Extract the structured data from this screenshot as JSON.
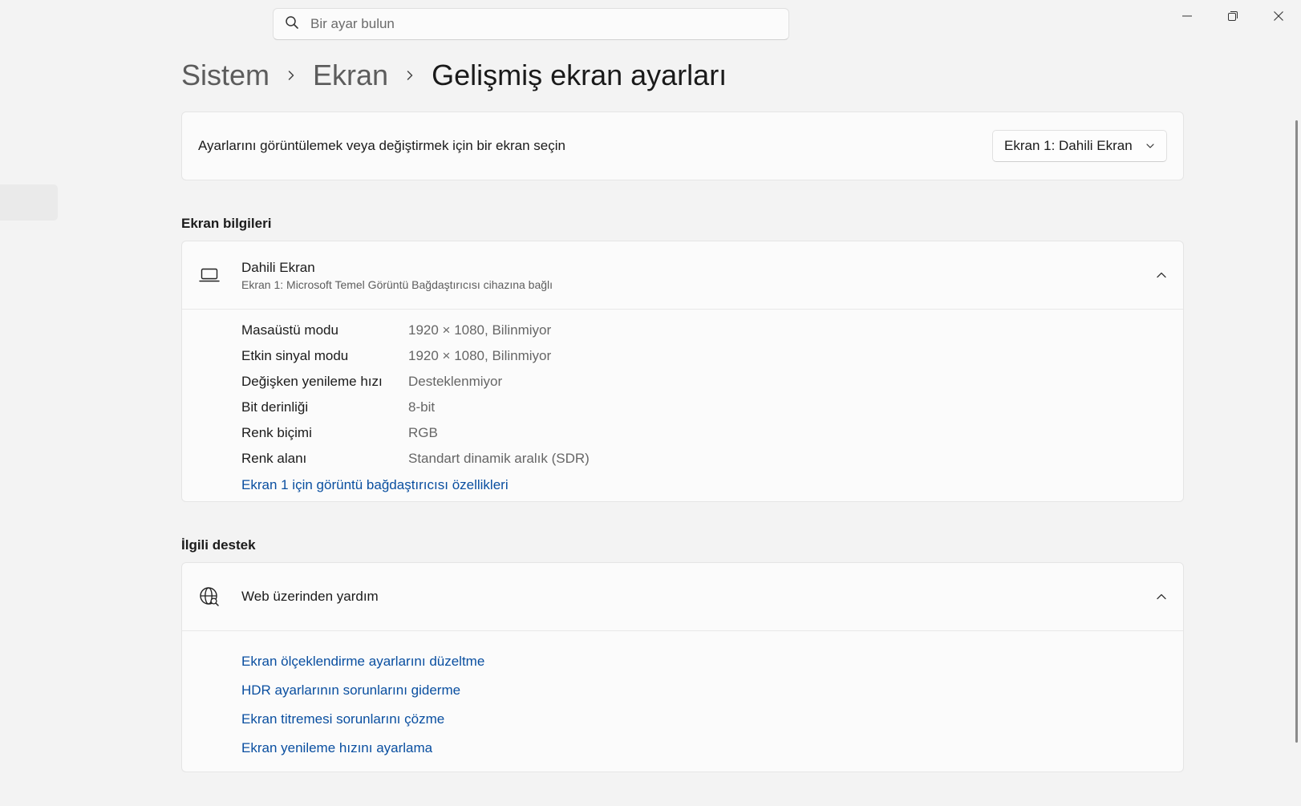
{
  "search": {
    "placeholder": "Bir ayar bulun"
  },
  "breadcrumb": {
    "items": [
      "Sistem",
      "Ekran"
    ],
    "current": "Gelişmiş ekran ayarları"
  },
  "display_select": {
    "label": "Ayarlarını görüntülemek veya değiştirmek için bir ekran seçin",
    "selected": "Ekran 1: Dahili Ekran"
  },
  "display_info": {
    "section_title": "Ekran bilgileri",
    "title": "Dahili Ekran",
    "subtitle": "Ekran 1: Microsoft Temel Görüntü Bağdaştırıcısı cihazına bağlı",
    "rows": [
      {
        "key": "Masaüstü modu",
        "value": "1920 × 1080, Bilinmiyor"
      },
      {
        "key": "Etkin sinyal modu",
        "value": "1920 × 1080, Bilinmiyor"
      },
      {
        "key": "Değişken yenileme hızı",
        "value": "Desteklenmiyor"
      },
      {
        "key": "Bit derinliği",
        "value": "8-bit"
      },
      {
        "key": "Renk biçimi",
        "value": "RGB"
      },
      {
        "key": "Renk alanı",
        "value": "Standart dinamik aralık (SDR)"
      }
    ],
    "adapter_link": "Ekran 1 için görüntü bağdaştırıcısı özellikleri"
  },
  "support": {
    "section_title": "İlgili destek",
    "title": "Web üzerinden yardım",
    "links": [
      "Ekran ölçeklendirme ayarlarını düzeltme",
      "HDR ayarlarının sorunlarını giderme",
      "Ekran titremesi sorunlarını çözme",
      "Ekran yenileme hızını ayarlama"
    ]
  },
  "icons": {
    "search": "search-icon",
    "minimize": "minimize-icon",
    "restore": "restore-icon",
    "close": "close-icon",
    "laptop": "laptop-icon",
    "globe": "globe-icon"
  },
  "colors": {
    "link": "#0a4fa0",
    "background": "#f3f3f3",
    "card": "#fbfbfb"
  }
}
